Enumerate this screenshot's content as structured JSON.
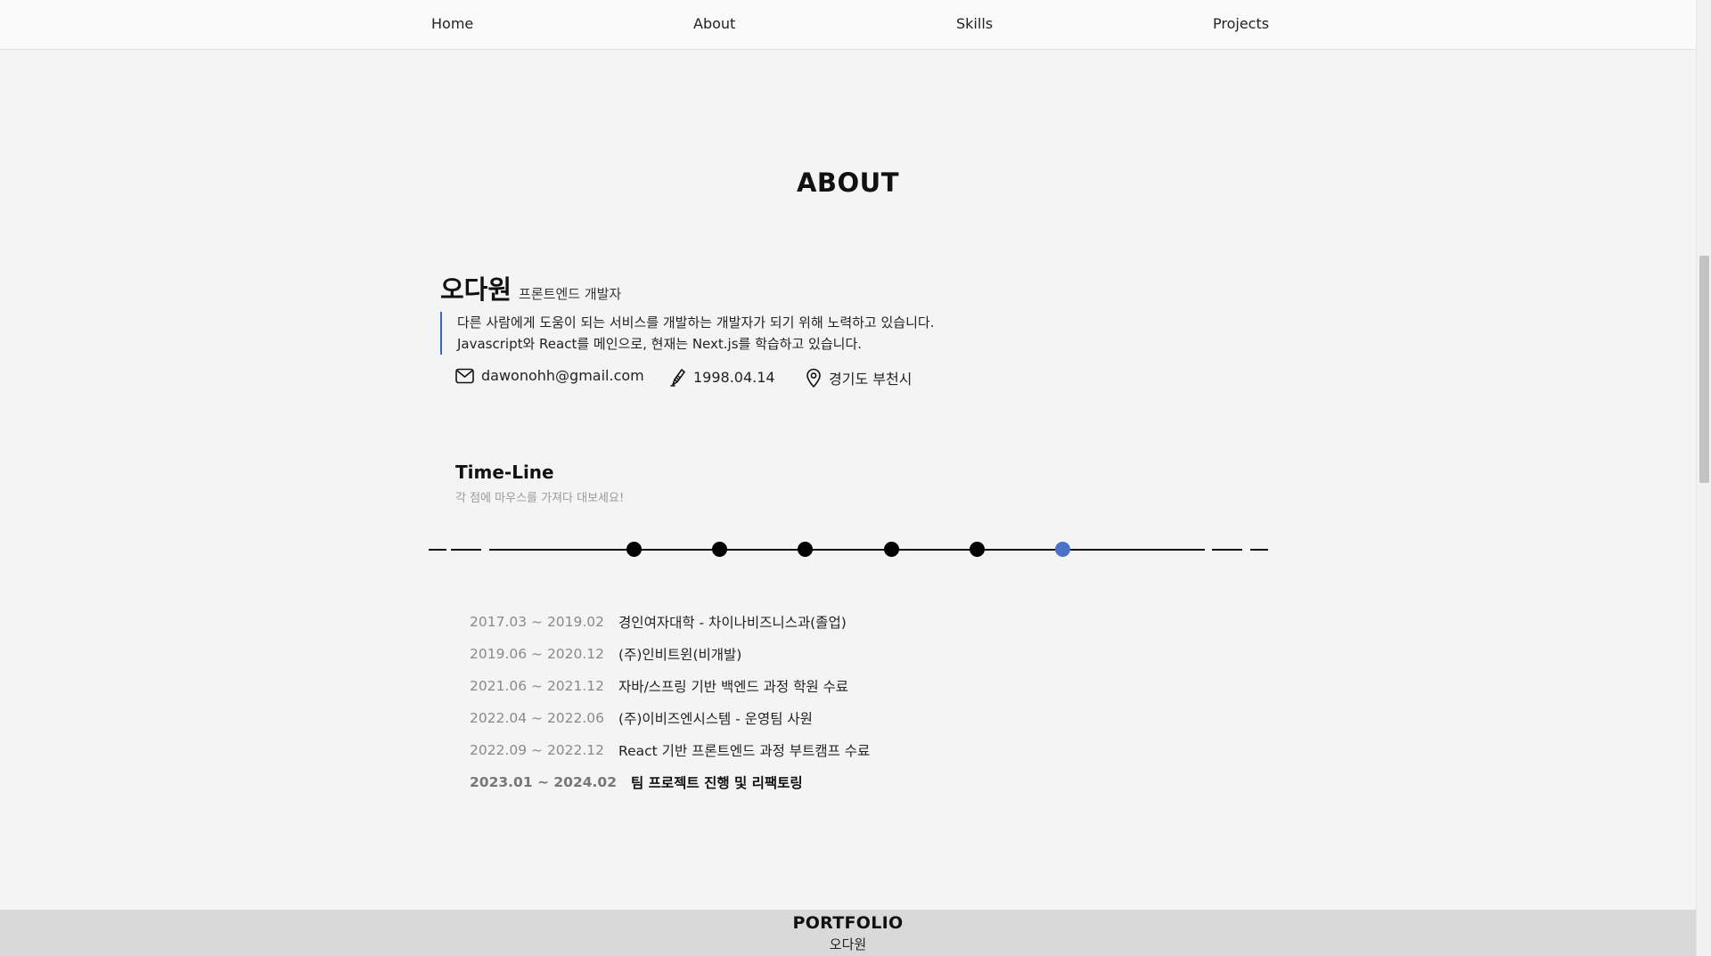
{
  "nav": {
    "items": [
      {
        "label": "Home"
      },
      {
        "label": "About"
      },
      {
        "label": "Skills"
      },
      {
        "label": "Projects"
      }
    ]
  },
  "about": {
    "title": "ABOUT",
    "name": "오다원",
    "role": "프론트엔드 개발자",
    "intro_lines": [
      "다른 사람에게 도움이 되는 서비스를 개발하는 개발자가 되기 위해 노력하고 있습니다.",
      "Javascript와 React를 메인으로, 현재는 Next.js를 학습하고 있습니다."
    ],
    "contacts": {
      "email": {
        "icon": "mail-icon",
        "value": "dawonohh@gmail.com"
      },
      "birth": {
        "icon": "pen-icon",
        "value": "1998.04.14"
      },
      "location": {
        "icon": "location-pin-icon",
        "value": "경기도 부천시"
      }
    }
  },
  "timeline": {
    "title": "Time-Line",
    "subtitle": "각 점에 마우스를 가져다 대보세요!",
    "active_index": 5,
    "colors": {
      "dot": "#000000",
      "active_dot": "#4a72c8"
    },
    "items": [
      {
        "period": "2017.03 ~ 2019.02",
        "desc": "경인여자대학 - 차이나비즈니스과(졸업)"
      },
      {
        "period": "2019.06 ~ 2020.12",
        "desc": "(주)인비트윈(비개발)"
      },
      {
        "period": "2021.06 ~ 2021.12",
        "desc": "자바/스프링 기반 백엔드 과정 학원 수료"
      },
      {
        "period": "2022.04 ~ 2022.06",
        "desc": "(주)이비즈엔시스템 - 운영팀 사원"
      },
      {
        "period": "2022.09 ~ 2022.12",
        "desc": "React 기반 프론트엔드 과정 부트캠프 수료"
      },
      {
        "period": "2023.01 ~ 2024.02",
        "desc": "팀 프로젝트 진행 및 리팩토링"
      }
    ]
  },
  "footer": {
    "title": "PORTFOLIO",
    "name": "오다원"
  }
}
